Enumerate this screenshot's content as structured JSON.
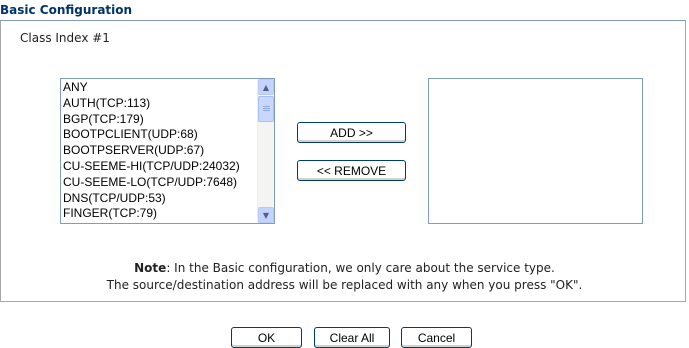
{
  "title": "Basic Configuration",
  "class_index": "Class Index #1",
  "service_list": {
    "items": [
      "ANY",
      "AUTH(TCP:113)",
      "BGP(TCP:179)",
      "BOOTPCLIENT(UDP:68)",
      "BOOTPSERVER(UDP:67)",
      "CU-SEEME-HI(TCP/UDP:24032)",
      "CU-SEEME-LO(TCP/UDP:7648)",
      "DNS(TCP/UDP:53)",
      "FINGER(TCP:79)"
    ]
  },
  "buttons": {
    "add": "ADD >>",
    "remove": "<< REMOVE",
    "ok": "OK",
    "clear_all": "Clear All",
    "cancel": "Cancel"
  },
  "note": {
    "label": "Note",
    "line1": ": In the Basic configuration, we only care about the service type.",
    "line2": "The source/destination address will be replaced with any when you press \"OK\"."
  },
  "colors": {
    "title": "#003366",
    "panel_border": "#a7a7a7",
    "button_border": "#003c74",
    "scrollbar": "#c3d3fd"
  },
  "icons": {
    "scroll_up": "chevron-up-icon",
    "scroll_down": "chevron-down-icon"
  }
}
